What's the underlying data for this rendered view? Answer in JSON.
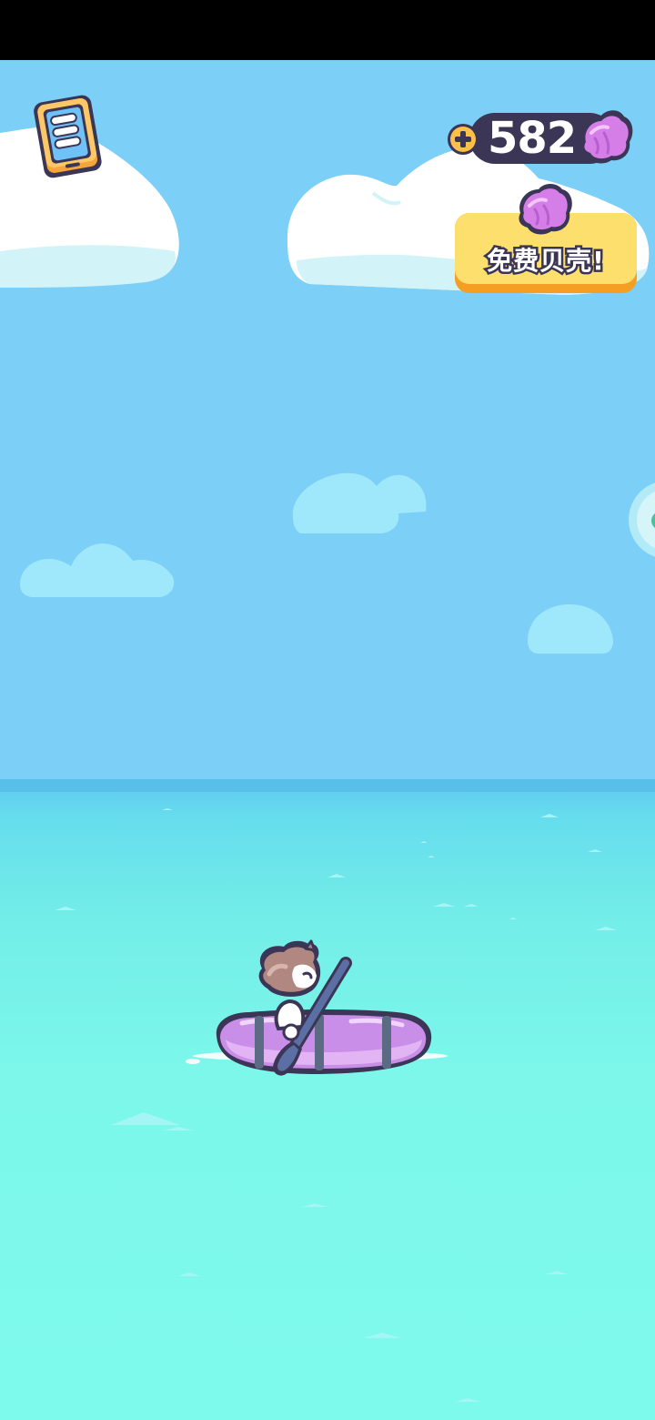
{
  "game": {
    "shell_count": "582",
    "free_shells_label": "免费贝壳!"
  },
  "colors": {
    "sky": "#7ccff7",
    "sea_top": "#5ec7ef",
    "sea_bottom": "#7efaec",
    "counter_pill": "#3b3556",
    "free_shells_button": "#fddf6d",
    "shell_pink": "#d48ce8",
    "boat_purple": "#c98ee8"
  },
  "icons": {
    "menu": "phone-menu-icon",
    "plus": "plus-icon",
    "shell": "shell-icon",
    "side": "side-bubble-icon"
  }
}
